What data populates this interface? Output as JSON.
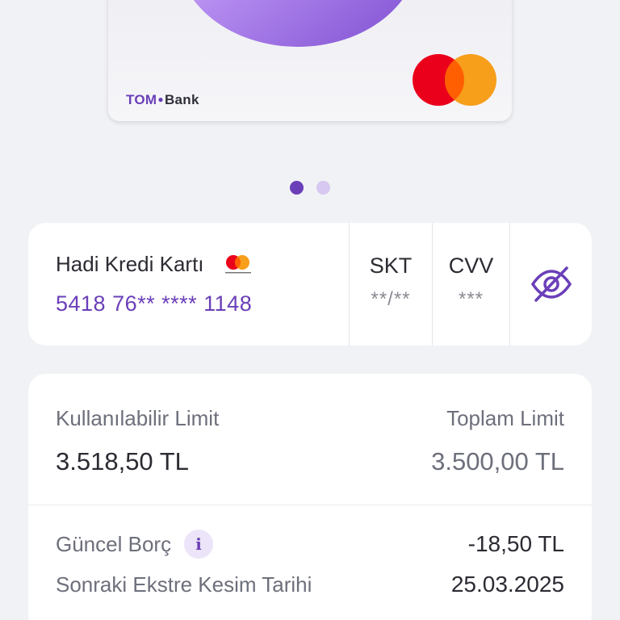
{
  "card": {
    "brand_tom": "TOM",
    "brand_bank": "Bank",
    "network_icon": "mastercard-icon"
  },
  "pagination": {
    "count": 2,
    "active_index": 0
  },
  "card_info": {
    "name": "Hadi Kredi Kartı",
    "number": "5418 76** **** 1148",
    "expiry_label": "SKT",
    "expiry_value": "**/**",
    "cvv_label": "CVV",
    "cvv_value": "***",
    "visibility_icon": "eye-off-icon"
  },
  "limits": {
    "available_label": "Kullanılabilir Limit",
    "available_value": "3.518,50 TL",
    "total_label": "Toplam Limit",
    "total_value": "3.500,00 TL",
    "current_debt_label": "Güncel Borç",
    "current_debt_value": "-18,50 TL",
    "next_statement_label": "Sonraki Ekstre Kesim Tarihi",
    "next_statement_value": "25.03.2025"
  },
  "colors": {
    "accent": "#6a3fb8",
    "background": "#f1f2f5",
    "mastercard_red": "#eb001b",
    "mastercard_orange": "#f79e1b"
  }
}
